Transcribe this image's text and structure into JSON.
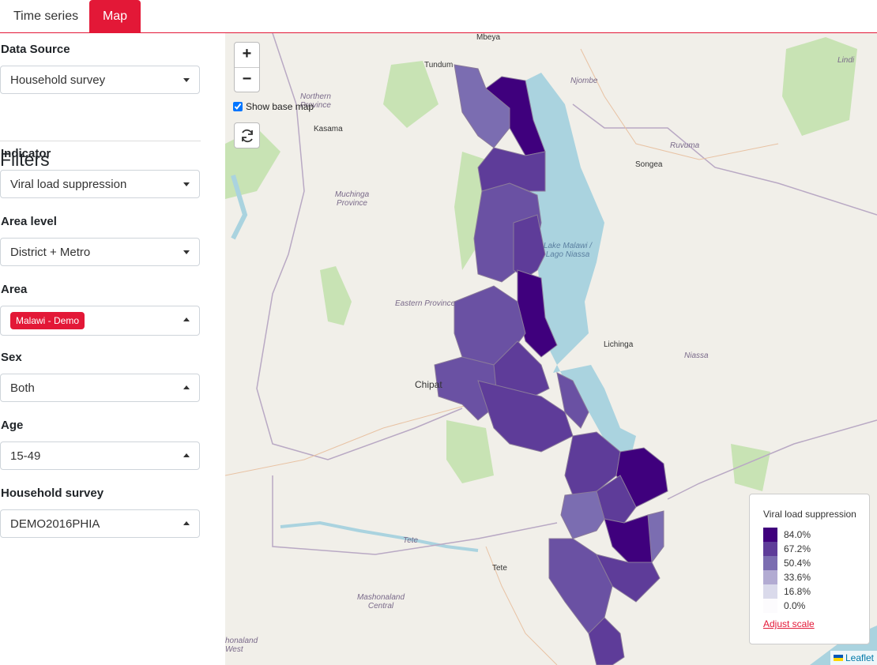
{
  "tabs": {
    "time_series": "Time series",
    "map": "Map"
  },
  "sidebar": {
    "data_source": {
      "label": "Data Source",
      "value": "Household survey"
    },
    "filters_title": "Filters",
    "indicator": {
      "label": "Indicator",
      "value": "Viral load suppression"
    },
    "area_level": {
      "label": "Area level",
      "value": "District + Metro"
    },
    "area": {
      "label": "Area",
      "value": "Malawi - Demo"
    },
    "sex": {
      "label": "Sex",
      "value": "Both"
    },
    "age": {
      "label": "Age",
      "value": "15-49"
    },
    "survey": {
      "label": "Household survey",
      "value": "DEMO2016PHIA"
    }
  },
  "map": {
    "zoom_in": "+",
    "zoom_out": "−",
    "show_base_map": "Show base map",
    "attribution": "Leaflet",
    "labels": {
      "mbeya": "Mbeya",
      "tundum": "Tundum",
      "njombe": "Njombe",
      "lindi": "Lindi",
      "northern_province": "Northern Province",
      "kasama": "Kasama",
      "ruvuma": "Ruvuma",
      "songea": "Songea",
      "muchinga": "Muchinga Province",
      "lake": "Lake Malawi / Lago Niassa",
      "eastern_province": "Eastern Province",
      "lichinga": "Lichinga",
      "niassa": "Niassa",
      "chipata": "Chipat",
      "tete_river": "Tete",
      "tete": "Tete",
      "mashonaland_central": "Mashonaland Central",
      "mashonaland_west": "honaland West"
    }
  },
  "legend": {
    "title": "Viral load suppression",
    "items": [
      {
        "label": "84.0%",
        "color": "#3f007d"
      },
      {
        "label": "67.2%",
        "color": "#5e3c99"
      },
      {
        "label": "50.4%",
        "color": "#7b6db1"
      },
      {
        "label": "33.6%",
        "color": "#b2abd2"
      },
      {
        "label": "16.8%",
        "color": "#dadaeb"
      },
      {
        "label": "0.0%",
        "color": "#fcfbfd"
      }
    ],
    "adjust_scale": "Adjust scale"
  }
}
